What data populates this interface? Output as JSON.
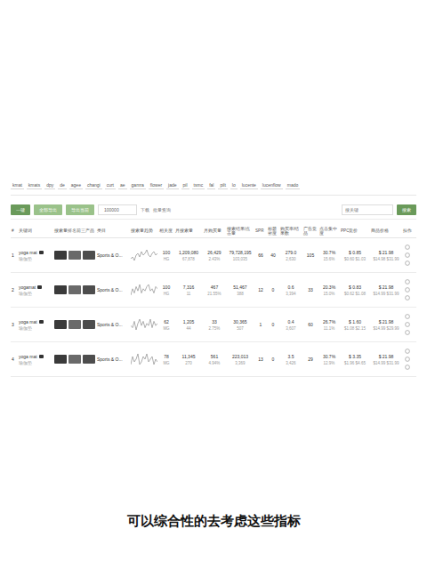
{
  "filters": {
    "chips": [
      "kmat",
      "kmats",
      "dpy",
      "de",
      "agee",
      "changi",
      "curt",
      "ae",
      "gamra",
      "flower",
      "jade",
      "pil",
      "tsmc",
      "fal",
      "pilt",
      "lo",
      "lucente",
      "lucenflow",
      "mado"
    ]
  },
  "toolbar": {
    "buttons": [
      "一键",
      "全部导出",
      "导出当前"
    ],
    "field_value": "100000",
    "links": [
      "下载",
      "批量查询"
    ],
    "search_placeholder": "搜关键",
    "search_button": "搜索"
  },
  "table": {
    "columns": [
      "#",
      "关键词",
      "搜索量排名前三产品",
      "类目",
      "搜索量趋势",
      "相关度",
      "月搜索量",
      "月购买量",
      "搜索结果/点击量",
      "SPR",
      "标题密度",
      "购买率/结果数",
      "广告竞品",
      "点击集中度",
      "PPC竞价",
      "商品价格",
      "操作"
    ],
    "rows": [
      {
        "index": "1",
        "keyword": "yoga mat",
        "keyword_sub": "瑜伽垫",
        "category": "Sports & O...",
        "trend": [
          5,
          6,
          4,
          7,
          8,
          6,
          9,
          7,
          8,
          10,
          7,
          6,
          8,
          9,
          7,
          8
        ],
        "cells": [
          [
            "100",
            "HG"
          ],
          [
            "1,209,080",
            "67,878"
          ],
          [
            "26,429",
            "2.43%"
          ],
          [
            "79,728,195",
            "103,035"
          ],
          [
            "66",
            ""
          ],
          [
            "40",
            ""
          ],
          [
            "279.0",
            "2,630"
          ],
          [
            "105",
            ""
          ],
          [
            "30.7%",
            "15.6%"
          ],
          [
            "$ 0.85",
            "$0.60 $1.03"
          ],
          [
            "$ 21.98",
            "$14.98 $31.99"
          ]
        ]
      },
      {
        "index": "2",
        "keyword": "yogamat",
        "keyword_sub": "瑜伽垫",
        "category": "Sports & O...",
        "trend": [
          4,
          7,
          5,
          8,
          6,
          9,
          5,
          7,
          6,
          8,
          9,
          6,
          7,
          5,
          8,
          7
        ],
        "cells": [
          [
            "100",
            "HG"
          ],
          [
            "7,316",
            "11"
          ],
          [
            "467",
            "21.55%"
          ],
          [
            "51,467",
            "388"
          ],
          [
            "12",
            ""
          ],
          [
            "0",
            ""
          ],
          [
            "0.6",
            "3,394"
          ],
          [
            "33",
            ""
          ],
          [
            "20.3%",
            "15.0%"
          ],
          [
            "$ 0.83",
            "$0.62 $1.08"
          ],
          [
            "$ 21.98",
            "$14.99 $31.99"
          ]
        ]
      },
      {
        "index": "3",
        "keyword": "yoga mat",
        "keyword_sub": "瑜伽垫",
        "category": "Sports & O...",
        "trend": [
          6,
          5,
          8,
          4,
          7,
          9,
          6,
          8,
          5,
          7,
          6,
          9,
          5,
          8,
          6,
          7
        ],
        "cells": [
          [
            "62",
            "MG"
          ],
          [
            "1,205",
            "44"
          ],
          [
            "33",
            "2.75%"
          ],
          [
            "30,365",
            "507"
          ],
          [
            "1",
            ""
          ],
          [
            "0",
            ""
          ],
          [
            "0.4",
            "3,607"
          ],
          [
            "60",
            ""
          ],
          [
            "26.7%",
            "11.1%"
          ],
          [
            "$ 1.60",
            "$1.08 $2.15"
          ],
          [
            "$ 21.98",
            "$14.99 $29.99"
          ]
        ]
      },
      {
        "index": "4",
        "keyword": "yoga mat",
        "keyword_sub": "瑜伽垫",
        "category": "Sports & O...",
        "trend": [
          5,
          8,
          6,
          7,
          9,
          5,
          6,
          8,
          7,
          9,
          6,
          7,
          8,
          5,
          7,
          6
        ],
        "cells": [
          [
            "78",
            "MG"
          ],
          [
            "11,345",
            "270"
          ],
          [
            "561",
            "4.94%"
          ],
          [
            "223,013",
            "3,369"
          ],
          [
            "13",
            ""
          ],
          [
            "0",
            ""
          ],
          [
            "3.5",
            "3,426"
          ],
          [
            "29",
            ""
          ],
          [
            "30.7%",
            "12.9%"
          ],
          [
            "$ 3.35",
            "$1.96 $4.65"
          ],
          [
            "$ 21.98",
            "$14.99 $31.99"
          ]
        ]
      }
    ]
  },
  "subtitle": "可以综合性的去考虑这些指标"
}
